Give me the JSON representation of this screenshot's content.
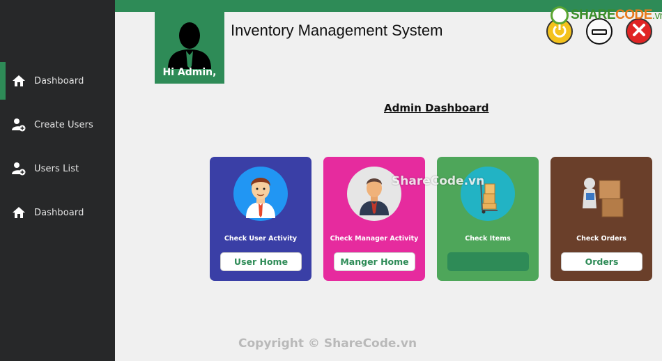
{
  "app": {
    "title": "Inventory Management System",
    "greeting": "Hi Admin,"
  },
  "sidebar": {
    "items": [
      {
        "label": "Dashboard",
        "icon": "home-icon",
        "active": true
      },
      {
        "label": "Create Users",
        "icon": "add-user-icon",
        "active": false
      },
      {
        "label": "Users List",
        "icon": "add-user-icon",
        "active": false
      },
      {
        "label": "Dashboard",
        "icon": "home-icon",
        "active": false
      }
    ]
  },
  "window_controls": {
    "power": "power-icon",
    "minimize": "minimize-icon",
    "close": "close-icon"
  },
  "main": {
    "section_title": "Admin Dashboard",
    "cards": [
      {
        "label": "Check User Activity",
        "button": "User Home",
        "color": "#3a3fa6",
        "image": "user-avatar-icon"
      },
      {
        "label": "Check Manager Activity",
        "button": "Manger Home",
        "color": "#e62b9e",
        "image": "manager-avatar-icon"
      },
      {
        "label": "Check Items",
        "button": "",
        "color": "#4ea65a",
        "image": "boxes-cart-icon"
      },
      {
        "label": "Check Orders",
        "button": "Orders",
        "color": "#6a3f2a",
        "image": "orders-boxes-icon"
      }
    ]
  },
  "watermarks": {
    "logo_prefix": "SHARE",
    "logo_mid": "CODE",
    "logo_suffix": ".vn",
    "center": "ShareCode.vn",
    "copyright": "Copyright © ShareCode.vn"
  },
  "colors": {
    "accent": "#2e8b57",
    "sidebar_bg": "#272829",
    "page_bg": "#f0f0f0"
  }
}
